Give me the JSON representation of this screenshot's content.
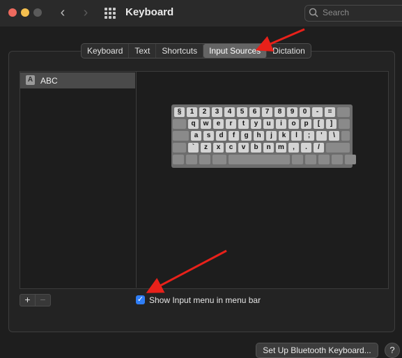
{
  "window": {
    "title": "Keyboard",
    "search_placeholder": "Search",
    "traffic_lights": {
      "close": "#ed6a5e",
      "minimize": "#f4bf4f",
      "zoom": "#5a5a5a"
    }
  },
  "tabs": [
    {
      "label": "Keyboard",
      "active": false
    },
    {
      "label": "Text",
      "active": false
    },
    {
      "label": "Shortcuts",
      "active": false
    },
    {
      "label": "Input Sources",
      "active": true
    },
    {
      "label": "Dictation",
      "active": false
    }
  ],
  "input_sources": {
    "items": [
      {
        "icon_letter": "A",
        "label": "ABC",
        "selected": true
      }
    ]
  },
  "keyboard": {
    "rows": [
      [
        "§",
        "1",
        "2",
        "3",
        "4",
        "5",
        "6",
        "7",
        "8",
        "9",
        "0",
        "-",
        "="
      ],
      [
        "q",
        "w",
        "e",
        "r",
        "t",
        "y",
        "u",
        "i",
        "o",
        "p",
        "[",
        "]"
      ],
      [
        "a",
        "s",
        "d",
        "f",
        "g",
        "h",
        "j",
        "k",
        "l",
        ";",
        "'",
        "\\"
      ],
      [
        "`",
        "z",
        "x",
        "c",
        "v",
        "b",
        "n",
        "m",
        ",",
        ".",
        "/"
      ]
    ]
  },
  "controls": {
    "add_label": "+",
    "remove_label": "−",
    "show_input_menu": {
      "checked": true,
      "check_glyph": "✓",
      "label": "Show Input menu in menu bar"
    },
    "bluetooth_button": "Set Up Bluetooth Keyboard...",
    "help_label": "?"
  },
  "colors": {
    "accent": "#2f7ef6",
    "annotation_arrow": "#e8211a"
  }
}
